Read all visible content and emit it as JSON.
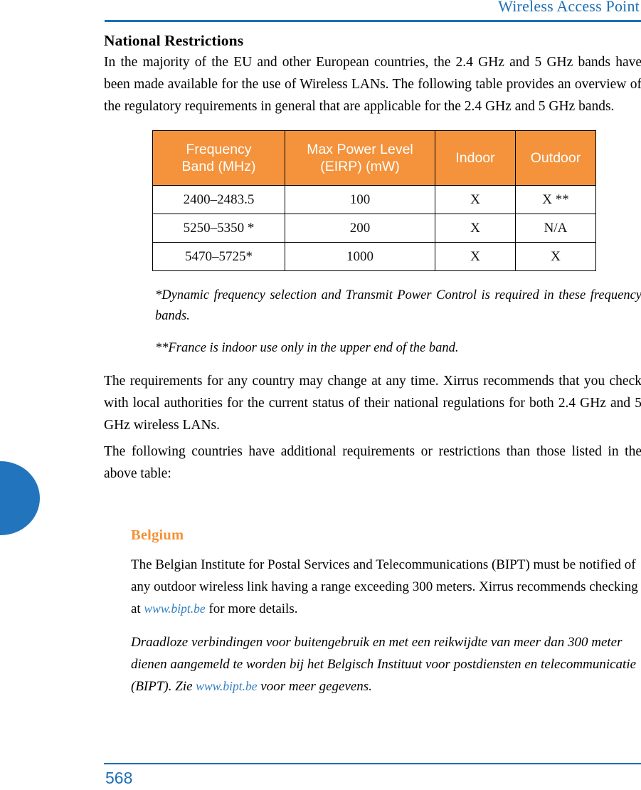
{
  "header": {
    "title": "Wireless Access Point"
  },
  "section": {
    "title": "National Restrictions",
    "intro": "In the majority of the EU and other European countries, the 2.4 GHz and 5 GHz bands have been made available for the use of Wireless LANs. The following table provides an overview of the regulatory requirements in general that are applicable for the 2.4 GHz and 5 GHz bands."
  },
  "table": {
    "columns": [
      "Frequency Band (MHz)",
      "Max Power Level (EIRP) (mW)",
      "Indoor",
      "Outdoor"
    ],
    "columns_lines": [
      [
        "Frequency",
        "Band (MHz)"
      ],
      [
        "Max Power Level",
        "(EIRP) (mW)"
      ],
      [
        "Indoor"
      ],
      [
        "Outdoor"
      ]
    ],
    "rows": [
      [
        "2400–2483.5",
        "100",
        "X",
        "X **"
      ],
      [
        "5250–5350 *",
        "200",
        "X",
        "N/A"
      ],
      [
        "5470–5725*",
        "1000",
        "X",
        "X"
      ]
    ]
  },
  "footnotes": [
    "*Dynamic frequency selection and Transmit Power Control is required in these frequency bands.",
    "**France is indoor use only in the upper end of the band."
  ],
  "paragraphs": {
    "requirements": "The requirements for any country may change at any time. Xirrus recommends that you check with local authorities for the current status of their national regulations for both 2.4 GHz and 5 GHz wireless LANs.",
    "following": "The following countries have additional requirements or restrictions than those listed in the above table:"
  },
  "country": {
    "title": "Belgium",
    "english_part1": "The Belgian Institute for Postal Services and Telecommunications (BIPT) must be notified of any outdoor wireless link having a range exceeding 300 meters. Xirrus recommends checking at ",
    "english_link": "www.bipt.be",
    "english_part2": " for more details.",
    "dutch_part1": "Draadloze verbindingen voor buitengebruik en met een reikwijdte van meer dan 300 meter dienen aangemeld te worden bij het Belgisch Instituut voor postdiensten en telecommunicatie (BIPT). Zie ",
    "dutch_link": "www.bipt.be",
    "dutch_part2": " voor meer gegevens."
  },
  "footer": {
    "page_number": "568"
  },
  "colors": {
    "accent_blue": "#1d6fb4",
    "tab_blue": "#2275bd",
    "table_orange": "#f4933c",
    "heading_orange": "#f4913a",
    "link_blue": "#2f7ec0"
  }
}
